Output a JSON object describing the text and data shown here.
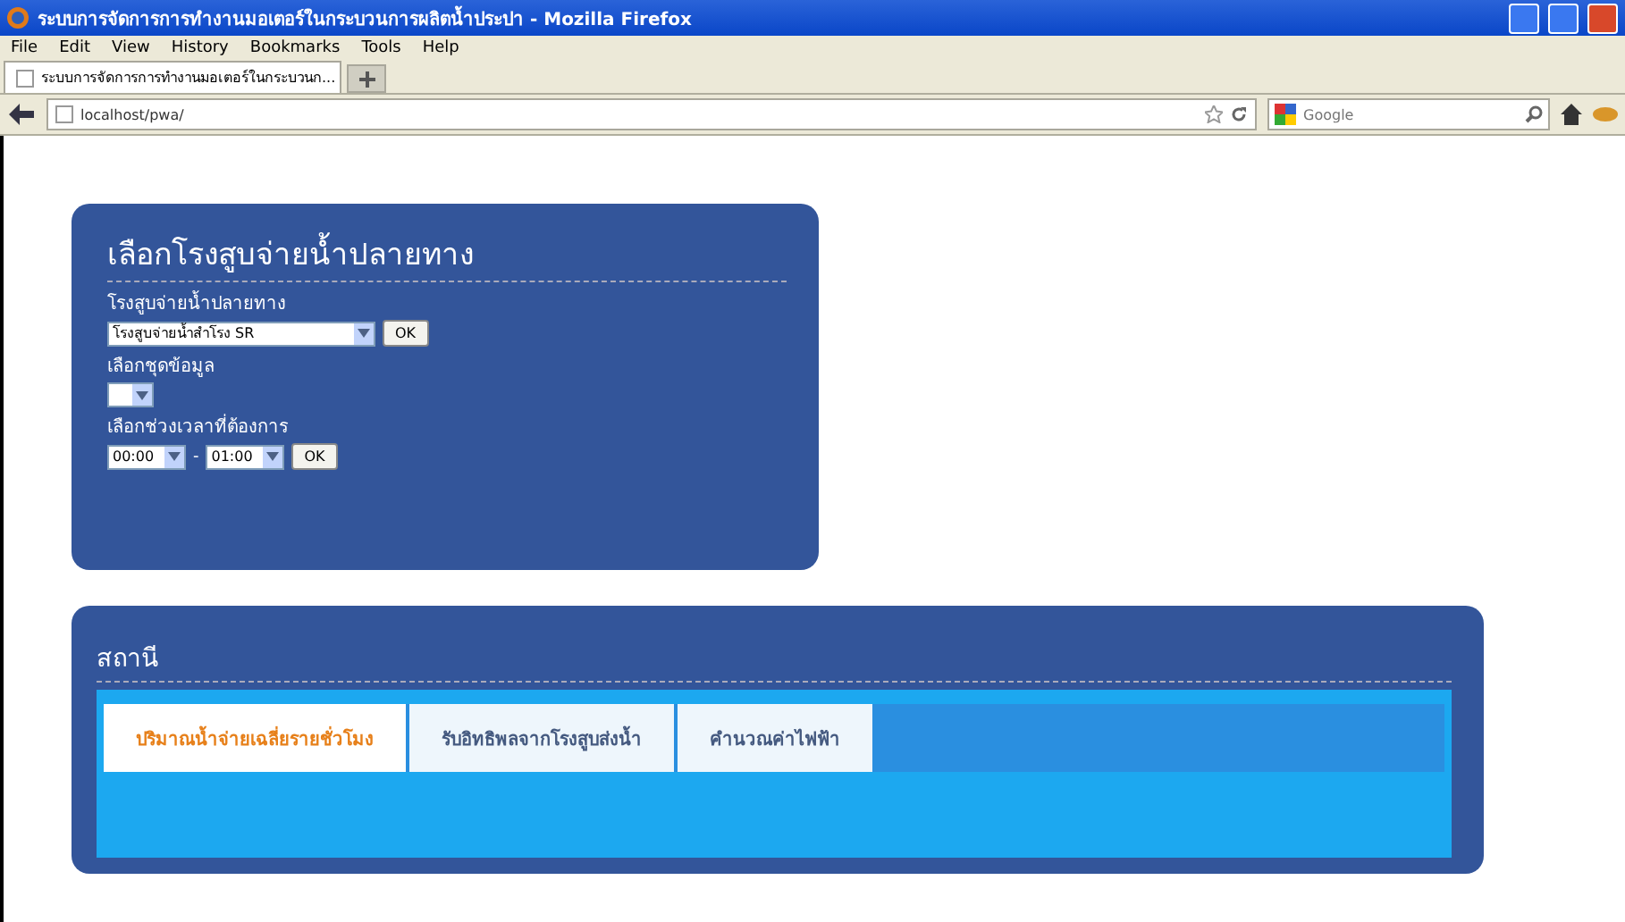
{
  "window": {
    "title": "ระบบการจัดการการทำงานมอเตอร์ในกระบวนการผลิตน้ำประปา - Mozilla Firefox"
  },
  "menu": [
    "File",
    "Edit",
    "View",
    "History",
    "Bookmarks",
    "Tools",
    "Help"
  ],
  "browser_tabs": [
    {
      "label": "ระบบการจัดการการทำงานมอเตอร์ในกระบวนก...",
      "selected": true
    }
  ],
  "address_bar": {
    "value": "localhost/pwa/"
  },
  "search": {
    "placeholder": "Google"
  },
  "destination_panel": {
    "title": "เลือกโรงสูบจ่ายน้ำปลายทาง",
    "fields": [
      {
        "label": "โรงสูบจ่ายน้ำปลายทาง",
        "kind": "select_ok",
        "selects": [
          "โรงสูบจ่ายน้ำสำโรง SR"
        ],
        "button": "OK"
      },
      {
        "label": "เลือกชุดข้อมูล",
        "kind": "select"
      },
      {
        "label": "เลือกช่วงเวลาที่ต้องการ",
        "kind": "range_ok",
        "selects": [
          "00:00",
          "01:00"
        ],
        "separator": "-",
        "button": "OK"
      }
    ]
  },
  "station_panel": {
    "title": "สถานี",
    "tabs": [
      {
        "label": "ปริมาณน้ำจ่ายเฉลี่ยรายชั่วโมง",
        "selected": true
      },
      {
        "label": "รับอิทธิพลจากโรงสูบส่งน้ำ",
        "selected": false
      },
      {
        "label": "คำนวณค่าไฟฟ้า",
        "selected": false
      }
    ]
  }
}
